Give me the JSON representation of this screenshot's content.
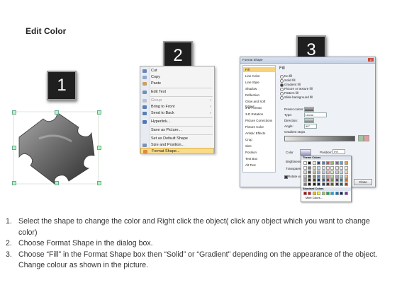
{
  "title": "Edit Color",
  "badges": [
    "1",
    "2",
    "3"
  ],
  "colors": {
    "badge_bg": "#1f1f1f",
    "menu_highlight": "#f9dc8a",
    "fill_selected": "#f7d37a"
  },
  "context_menu": {
    "items": [
      {
        "label": "Cut",
        "icon": "scissors-icon"
      },
      {
        "label": "Copy",
        "icon": "copy-icon"
      },
      {
        "label": "Paste",
        "icon": "paste-icon"
      },
      {
        "label": "Edit Text",
        "icon": "edit-text-icon"
      },
      {
        "label": "Group",
        "icon": "group-icon",
        "arrow": "›"
      },
      {
        "label": "Bring to Front",
        "icon": "bring-front-icon",
        "arrow": "›"
      },
      {
        "label": "Send to Back",
        "icon": "send-back-icon",
        "arrow": "›"
      },
      {
        "label": "Hyperlink...",
        "icon": "hyperlink-icon"
      },
      {
        "label": "Save as Picture...",
        "icon": ""
      },
      {
        "label": "Set as Default Shape",
        "icon": ""
      },
      {
        "label": "Size and Position...",
        "icon": "size-icon"
      },
      {
        "label": "Format Shape...",
        "icon": "format-shape-icon"
      }
    ]
  },
  "dialog": {
    "title": "Format Shape",
    "close": "x",
    "left_items": [
      "Fill",
      "Line Color",
      "Line Style",
      "Shadow",
      "Reflection",
      "Glow and Soft Edges",
      "3-D Format",
      "3-D Rotation",
      "Picture Corrections",
      "Picture Color",
      "Artistic Effects",
      "Crop",
      "Size",
      "Position",
      "Text Box",
      "Alt Text"
    ],
    "section_title": "Fill",
    "fill_options": [
      "No fill",
      "Solid fill",
      "Gradient fill",
      "Picture or texture fill",
      "Pattern fill",
      "Slide background fill"
    ],
    "selected_fill": 2,
    "preset_colors_label": "Preset colors:",
    "type_label": "Type:",
    "type_value": "Linear",
    "direction_label": "Direction:",
    "angle_label": "Angle:",
    "angle_value": "90°",
    "gradient_stops_label": "Gradient stops",
    "color_label": "Color",
    "position_label": "Position:",
    "position_value": "0%",
    "brightness_label": "Brightness:",
    "transparency_label": "Transparency:",
    "rotate_label": "Rotate w",
    "close_button": "Close"
  },
  "palette": {
    "theme_header": "Theme Colors",
    "standard_header": "Standard Colors",
    "more_colors": "More Colors...",
    "theme_top": [
      "#ffffff",
      "#000000",
      "#eeece1",
      "#1f497d",
      "#4f81bd",
      "#c0504d",
      "#9bbb59",
      "#8064a2",
      "#4bacc6",
      "#f79646"
    ],
    "theme_shades": [
      [
        "#f2f2f2",
        "#7f7f7f",
        "#ddd9c3",
        "#c6d9f0",
        "#dbe5f1",
        "#f2dcdb",
        "#ebf1dd",
        "#e5e0ec",
        "#dbeef3",
        "#fdeada"
      ],
      [
        "#d8d8d8",
        "#595959",
        "#c4bd97",
        "#8db3e2",
        "#b8cce4",
        "#e5b9b7",
        "#d7e3bc",
        "#ccc1d9",
        "#b7dde8",
        "#fbd5b5"
      ],
      [
        "#bfbfbf",
        "#3f3f3f",
        "#938953",
        "#548dd4",
        "#95b3d7",
        "#d99694",
        "#c3d69b",
        "#b2a2c7",
        "#92cddc",
        "#fac08f"
      ],
      [
        "#a5a5a5",
        "#262626",
        "#494429",
        "#17365d",
        "#366092",
        "#953734",
        "#76923c",
        "#5f497a",
        "#31859b",
        "#e36c09"
      ],
      [
        "#7f7f7f",
        "#0c0c0c",
        "#1d1b10",
        "#0f243e",
        "#244061",
        "#632423",
        "#4f6128",
        "#3f3151",
        "#205867",
        "#974806"
      ]
    ],
    "standard": [
      "#c00000",
      "#ff0000",
      "#ffc000",
      "#ffff00",
      "#92d050",
      "#00b050",
      "#00b0f0",
      "#0070c0",
      "#002060",
      "#7030a0"
    ]
  },
  "steps": [
    {
      "num": "1.",
      "text": "Select the shape to change the color and Right click the object( click any object which you want to change color)"
    },
    {
      "num": "2.",
      "text": "Choose Format Shape in the dialog box."
    },
    {
      "num": "3.",
      "text": "Choose “Fill” in the Format Shape box then “Solid” or “Gradient” depending on the appearance of the object. Change colour as shown in the picture."
    }
  ]
}
